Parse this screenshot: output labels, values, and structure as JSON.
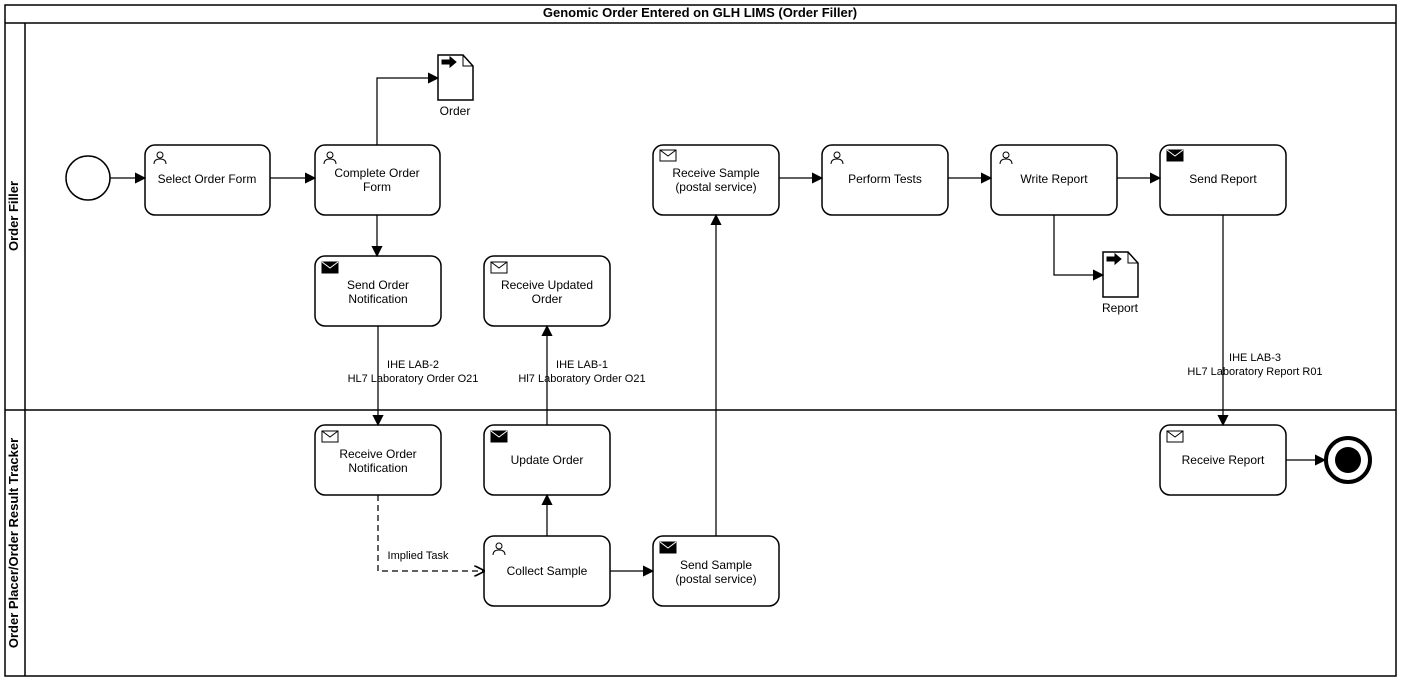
{
  "pool": {
    "title": "Genomic Order Entered on GLH LIMS (Order Filler)"
  },
  "lanes": {
    "filler": "Order Filler",
    "placer": "Order Placer/Order Result Tracker"
  },
  "tasks": {
    "selectOrderForm": "Select Order Form",
    "completeOrderForm_l1": "Complete  Order",
    "completeOrderForm_l2": "Form",
    "sendOrderNotification_l1": "Send Order",
    "sendOrderNotification_l2": "Notification",
    "receiveUpdatedOrder_l1": "Receive  Updated",
    "receiveUpdatedOrder_l2": "Order",
    "receiveSample_l1": "Receive  Sample",
    "receiveSample_l2": "(postal service)",
    "performTests": "Perform Tests",
    "writeReport": "Write Report",
    "sendReport": "Send Report",
    "receiveOrderNotification_l1": "Receive Order",
    "receiveOrderNotification_l2": "Notification",
    "updateOrder": "Update Order",
    "collectSample": "Collect Sample",
    "sendSample_l1": "Send Sample",
    "sendSample_l2": "(postal service)",
    "receiveReport": "Receive Report"
  },
  "artifacts": {
    "order": "Order",
    "report": "Report"
  },
  "labels": {
    "iheLab2_l1": "IHE LAB-2",
    "iheLab2_l2": "HL7 Laboratory Order O21",
    "iheLab1_l1": "IHE LAB-1",
    "iheLab1_l2": "Hl7 Laboratory Order O21",
    "iheLab3_l1": "IHE LAB-3",
    "iheLab3_l2": "HL7 Laboratory Report R01",
    "impliedTask": "Implied Task"
  }
}
